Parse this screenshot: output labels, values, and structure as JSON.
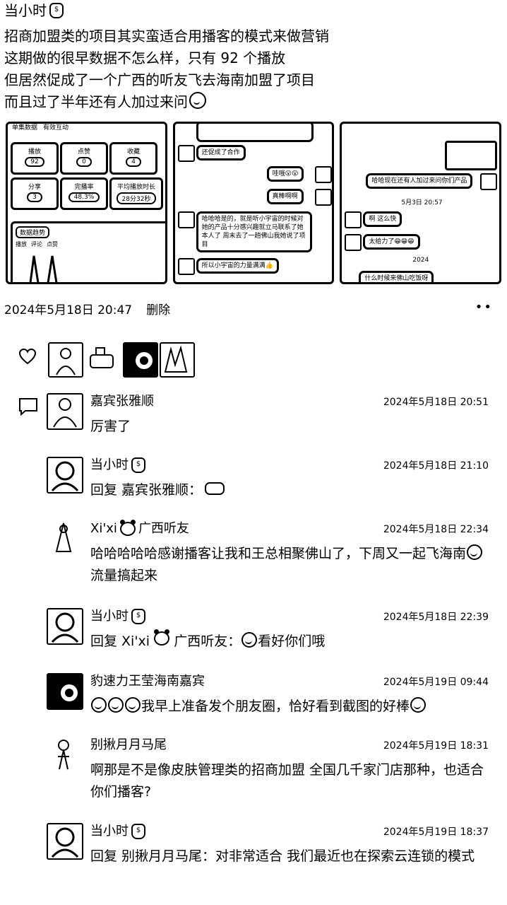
{
  "post": {
    "author": "当小时",
    "lines": [
      "招商加盟类的项目其实蛮适合用播客的模式来做营销",
      "这期做的很早数据不怎么样，只有 92 个播放",
      "但居然促成了一个广西的听友飞去海南加盟了项目",
      "而且过了半年还有人加过来问"
    ],
    "timestamp": "2024年5月18日 20:47",
    "delete_label": "删除",
    "more_label": "••"
  },
  "thumb1": {
    "top_labels": [
      "单集数据",
      "有效互动"
    ],
    "stats": [
      {
        "label": "播放",
        "value": "92"
      },
      {
        "label": "点赞",
        "value": "0"
      },
      {
        "label": "收藏",
        "value": "4"
      },
      {
        "label": "分享",
        "value": "3"
      },
      {
        "label": "完播率",
        "value": "48.3%"
      },
      {
        "label": "平均播放时长",
        "value": "28分32秒"
      }
    ],
    "trend_label": "数据趋势",
    "trend_tabs": [
      "播放",
      "评论",
      "点赞"
    ]
  },
  "thumb2": {
    "messages": [
      "还促成了合作",
      "哇哦😮😮",
      "真棒啊啊",
      "哈哈哈是的，就是听小宇宙的时候对她的产品十分感兴趣就立马联系了她本人了 周末去了一趟佛山我她说了项目",
      "所以小宇宙的力量满满👍"
    ]
  },
  "thumb3": {
    "messages": [
      "哈哈现在还有人加过来问你们产品",
      "啊 这么快",
      "太给力了😁😁😁",
      "什么时候来佛山吃饭呀"
    ],
    "date1": "5月3日 20:57",
    "date2": "2024"
  },
  "comments": [
    {
      "name": "嘉宾张雅顺",
      "time": "2024年5月18日 20:51",
      "text": "厉害了"
    },
    {
      "name": "当小时",
      "time": "2024年5月18日 21:10",
      "text": "回复 嘉宾张雅顺："
    },
    {
      "name": "Xi'xi",
      "name_suffix": "广西听友",
      "time": "2024年5月18日 22:34",
      "text": "哈哈哈哈哈感谢播客让我和王总相聚佛山了，下周又一起飞海南",
      "text_tail": "流量搞起来"
    },
    {
      "name": "当小时",
      "time": "2024年5月18日 22:39",
      "text_prefix": "回复 Xi'xi",
      "text_mid": "广西听友：",
      "text": "看好你们哦"
    },
    {
      "name": "豹速力王莹海南嘉宾",
      "time": "2024年5月19日 09:44",
      "text": "我早上准备发个朋友圈，恰好看到截图的好棒"
    },
    {
      "name": "别揪月月马尾",
      "time": "2024年5月19日 18:31",
      "text": "啊那是不是像皮肤管理类的招商加盟 全国几千家门店那种，也适合你们播客?"
    },
    {
      "name": "当小时",
      "time": "2024年5月19日 18:37",
      "text": "回复 别揪月月马尾：对非常适合 我们最近也在探索云连锁的模式"
    }
  ]
}
